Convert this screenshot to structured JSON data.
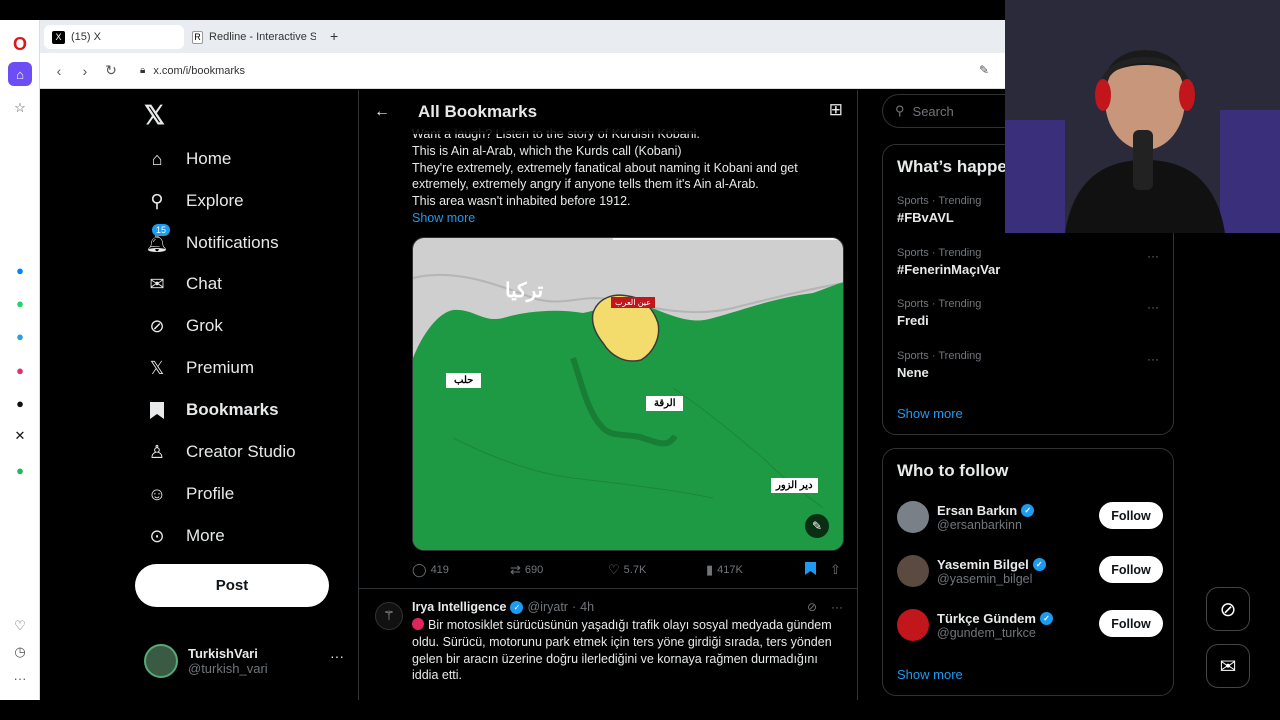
{
  "browser": {
    "tabs": [
      {
        "label": "(15) X",
        "active": true
      },
      {
        "label": "Redline - Interactive Strate",
        "active": false
      }
    ],
    "url": "x.com/i/bookmarks"
  },
  "nav": {
    "items": [
      {
        "label": "Home",
        "icon": "home-icon"
      },
      {
        "label": "Explore",
        "icon": "search-icon"
      },
      {
        "label": "Notifications",
        "icon": "bell-icon",
        "badge": "15"
      },
      {
        "label": "Chat",
        "icon": "mail-icon"
      },
      {
        "label": "Grok",
        "icon": "grok-icon"
      },
      {
        "label": "Premium",
        "icon": "x-icon"
      },
      {
        "label": "Bookmarks",
        "icon": "bookmark-icon"
      },
      {
        "label": "Creator Studio",
        "icon": "creator-icon"
      },
      {
        "label": "Profile",
        "icon": "person-icon"
      },
      {
        "label": "More",
        "icon": "more-circle-icon"
      }
    ],
    "post_label": "Post",
    "account": {
      "name": "TurkishVari",
      "handle": "@turkish_vari"
    }
  },
  "main": {
    "title": "All Bookmarks",
    "tweet1": {
      "lines": [
        "Want a laugh? Listen to the story of Kurdish Kobani.",
        "This is Ain al-Arab, which the Kurds call (Kobani)",
        "They're extremely, extremely fanatical about naming it Kobani and get",
        "extremely, extremely angry if anyone tells them it's Ain al-Arab.",
        "This area wasn't inhabited before 1912."
      ],
      "show_more": "Show more",
      "map_labels": {
        "turkey": "تركيا",
        "ain_al_arab": "عين العرب",
        "aleppo": "حلب",
        "raqqa": "الرقة",
        "deir_ezzor": "دير الزور"
      },
      "stats": {
        "replies": "419",
        "reposts": "690",
        "likes": "5.7K",
        "views": "417K"
      }
    },
    "tweet2": {
      "name": "Irya Intelligence",
      "handle": "@iryatr",
      "time": "4h",
      "body": "Bir motosiklet sürücüsünün yaşadığı trafik olayı sosyal medyada gündem oldu. Sürücü, motorunu park etmek için ters yöne girdiği sırada, ters yönden gelen bir aracın üzerine doğru ilerlediğini ve kornaya rağmen durmadığını iddia etti."
    }
  },
  "right": {
    "search_placeholder": "Search",
    "trends_title": "What’s happe",
    "trends": [
      {
        "category": "Sports · Trending",
        "name": "#FBvAVL"
      },
      {
        "category": "Sports · Trending",
        "name": "#FenerinMaçıVar"
      },
      {
        "category": "Sports · Trending",
        "name": "Fredi"
      },
      {
        "category": "Sports · Trending",
        "name": "Nene"
      }
    ],
    "trends_more": "Show more",
    "who_title": "Who to follow",
    "who": [
      {
        "name": "Ersan Barkın",
        "handle": "@ersanbarkinn",
        "follow": "Follow",
        "avatar_color": "#7a8088"
      },
      {
        "name": "Yasemin Bilgel",
        "handle": "@yasemin_bilgel",
        "follow": "Follow",
        "avatar_color": "#5a4a40"
      },
      {
        "name": "Türkçe Gündem",
        "handle": "@gundem_turkce",
        "follow": "Follow",
        "avatar_color": "#c0161c"
      }
    ],
    "who_more": "Show more"
  },
  "colors": {
    "accent": "#1d9bf0",
    "map_green": "#1f9a44",
    "map_yellow": "#f3dc6c",
    "map_gray": "#cfcfcf"
  }
}
